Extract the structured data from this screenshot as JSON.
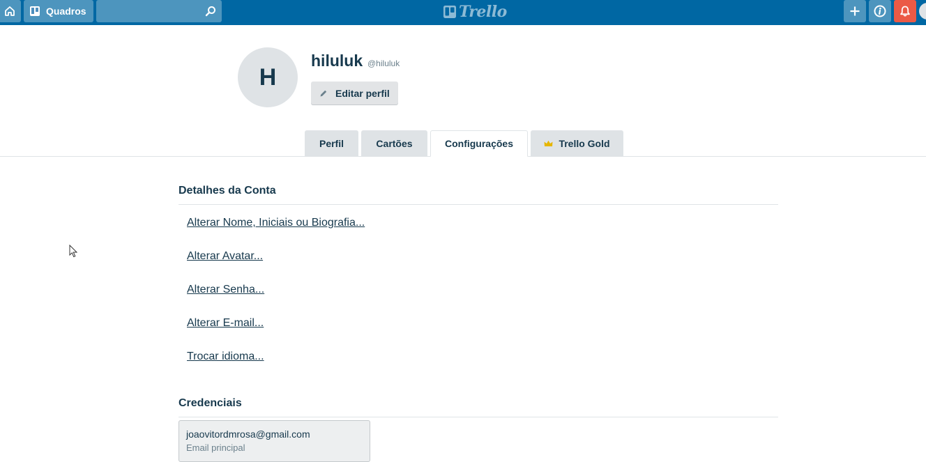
{
  "header": {
    "boards_label": "Quadros",
    "search_placeholder": "",
    "logo_text": "Trello",
    "colors": {
      "bar": "#0067a3",
      "notification": "#eb5a46"
    },
    "icons": [
      "home-icon",
      "boards-icon",
      "search-icon",
      "trello-logo-icon",
      "plus-icon",
      "info-icon",
      "bell-icon"
    ]
  },
  "profile": {
    "initial": "H",
    "name": "hiluluk",
    "username": "@hiluluk",
    "edit_label": "Editar perfil"
  },
  "tabs": [
    {
      "label": "Perfil",
      "active": false
    },
    {
      "label": "Cartões",
      "active": false
    },
    {
      "label": "Configurações",
      "active": true
    },
    {
      "label": "Trello Gold",
      "active": false
    }
  ],
  "account": {
    "title": "Detalhes da Conta",
    "links": [
      "Alterar Nome, Iniciais ou Biografia...",
      "Alterar Avatar...",
      "Alterar Senha...",
      "Alterar E-mail...",
      "Trocar idioma..."
    ]
  },
  "credentials": {
    "title": "Credenciais",
    "email": "joaovitordmrosa@gmail.com",
    "email_label": "Email principal"
  }
}
